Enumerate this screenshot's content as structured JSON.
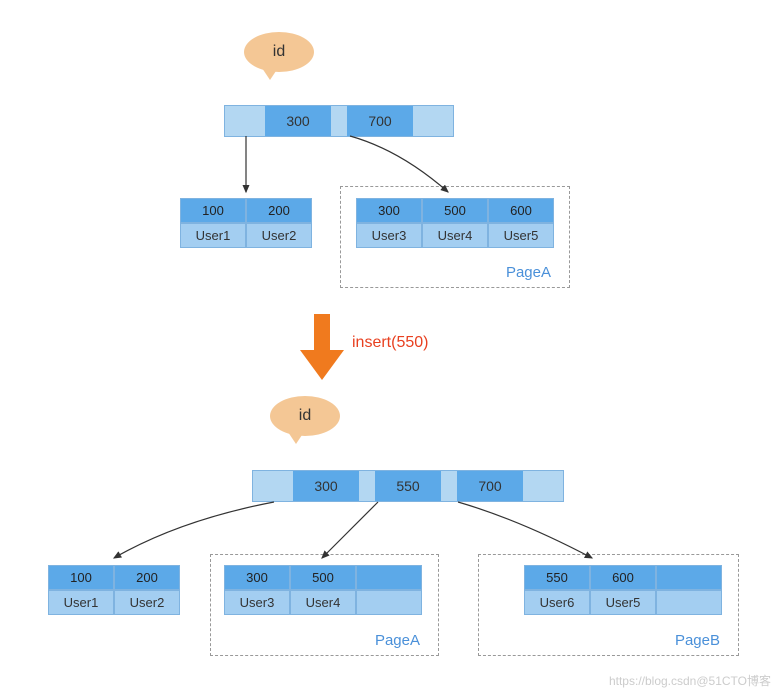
{
  "bubble_label": "id",
  "before": {
    "root_keys": [
      "300",
      "700"
    ],
    "leaf_left": {
      "keys": [
        "100",
        "200"
      ],
      "values": [
        "User1",
        "User2"
      ]
    },
    "page_a": {
      "keys": [
        "300",
        "500",
        "600"
      ],
      "values": [
        "User3",
        "User4",
        "User5"
      ],
      "label": "PageA"
    }
  },
  "action": {
    "label": "insert(550)",
    "arrow_color": "#f07a1e"
  },
  "after": {
    "root_keys": [
      "300",
      "550",
      "700"
    ],
    "leaf_left": {
      "keys": [
        "100",
        "200"
      ],
      "values": [
        "User1",
        "User2"
      ]
    },
    "page_a": {
      "keys": [
        "300",
        "500",
        ""
      ],
      "values": [
        "User3",
        "User4",
        ""
      ],
      "label": "PageA"
    },
    "page_b": {
      "keys": [
        "550",
        "600",
        ""
      ],
      "values": [
        "User6",
        "User5",
        ""
      ],
      "label": "PageB"
    }
  },
  "watermark": "https://blog.csdn@51CTO博客"
}
